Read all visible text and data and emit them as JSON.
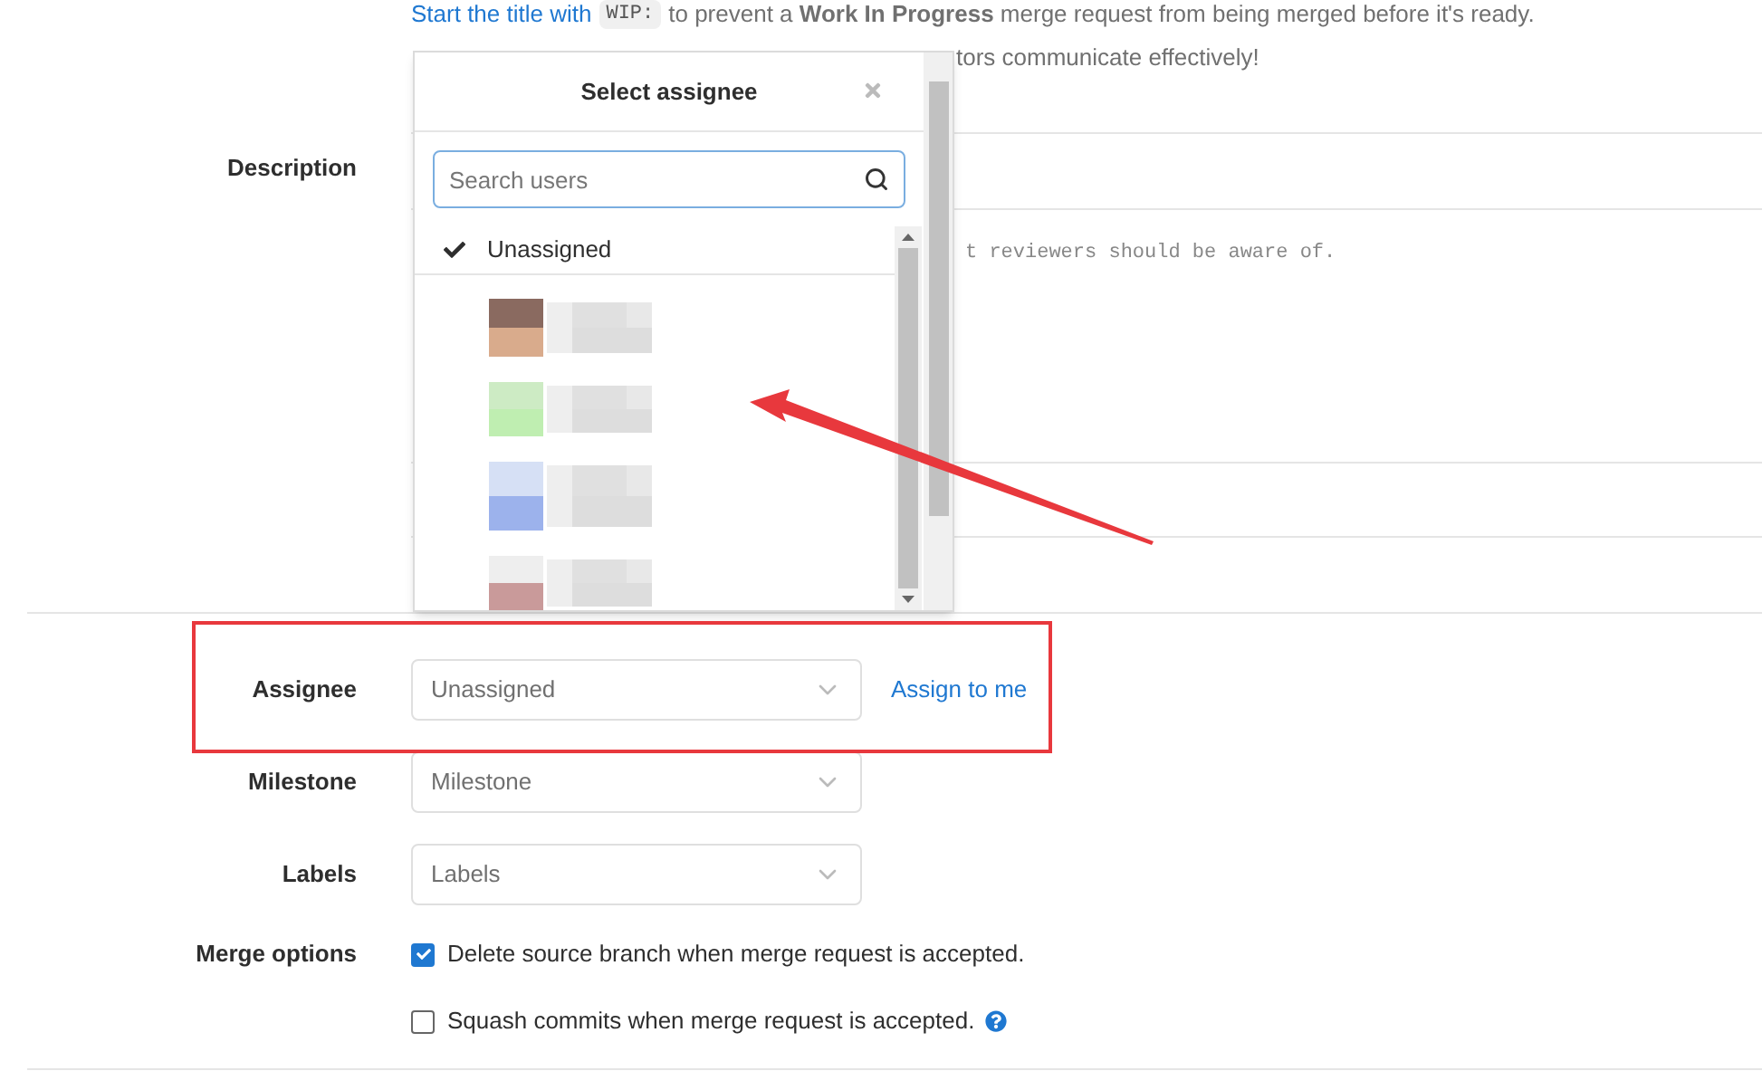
{
  "hint": {
    "link": "Start the title with",
    "code": "WIP:",
    "text": "to prevent a **Work In Progress** merge request from being merged before it's ready."
  },
  "hint_fragment": "tors communicate effectively!",
  "description": {
    "label": "Description",
    "placeholder_fragment": "t reviewers should be aware of."
  },
  "assignee_dropdown": {
    "title": "Select assignee",
    "search": {
      "placeholder": "Search users"
    },
    "options": [
      {
        "label": "Unassigned",
        "selected": true
      }
    ]
  },
  "fields": [
    {
      "label": "Assignee",
      "value": "Unassigned",
      "action": "Assign to me"
    },
    {
      "label": "Milestone",
      "value": "Milestone"
    },
    {
      "label": "Labels",
      "value": "Labels"
    }
  ],
  "merge_options": {
    "label": "Merge options",
    "options": [
      {
        "label": "Delete source branch when merge request is accepted.",
        "checked": true,
        "help": false
      },
      {
        "label": "Squash commits when merge request is accepted.",
        "checked": false,
        "help": true
      }
    ]
  }
}
